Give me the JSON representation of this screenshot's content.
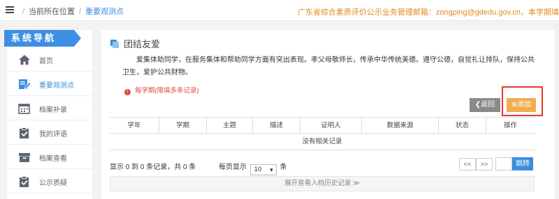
{
  "breadcrumb": {
    "home": "当前所在位置",
    "current": "重要观测点"
  },
  "notice": "广东省综合素质评价公示业务管理邮箱：zongping@gdedu.gov.cn，本学期填",
  "sidebar": {
    "title": "系统导航",
    "items": [
      {
        "label": "首页",
        "icon": "home-icon"
      },
      {
        "label": "重要观测点",
        "icon": "edit-document-icon"
      },
      {
        "label": "档案补录",
        "icon": "calendar-icon"
      },
      {
        "label": "我的评语",
        "icon": "clipboard-check-icon"
      },
      {
        "label": "档案查看",
        "icon": "archive-box-icon"
      },
      {
        "label": "公示质疑",
        "icon": "clipboard-check-icon"
      }
    ]
  },
  "main": {
    "title": "团结友爱",
    "description": "爱集体助同学，在服务集体和帮助同学方面有突出表现。孝父母敬师长，传承中华传统美德。遵守公德，自觉礼让排队，保持公共卫生，爱护公共财物。",
    "tip": "每学期(限填多条记录)",
    "back_label": "返回",
    "add_label": "添加",
    "columns": [
      "学年",
      "学期",
      "主题",
      "描述",
      "证明人",
      "数据来源",
      "状态",
      "操作"
    ],
    "empty_text": "没有相关记录",
    "pager_info": "显示 0 到 0 条记录，共 0 条",
    "per_page_prefix": "每页显示",
    "per_page_value": "10",
    "per_page_suffix": "条",
    "prev_label": "<<",
    "next_label": ">>",
    "go_label": "跳转",
    "history_label": "展开查看入档历史记录 ≫"
  },
  "colors": {
    "accent": "#3b8ede",
    "warning": "#f0ad4e",
    "danger": "#e0483d"
  }
}
